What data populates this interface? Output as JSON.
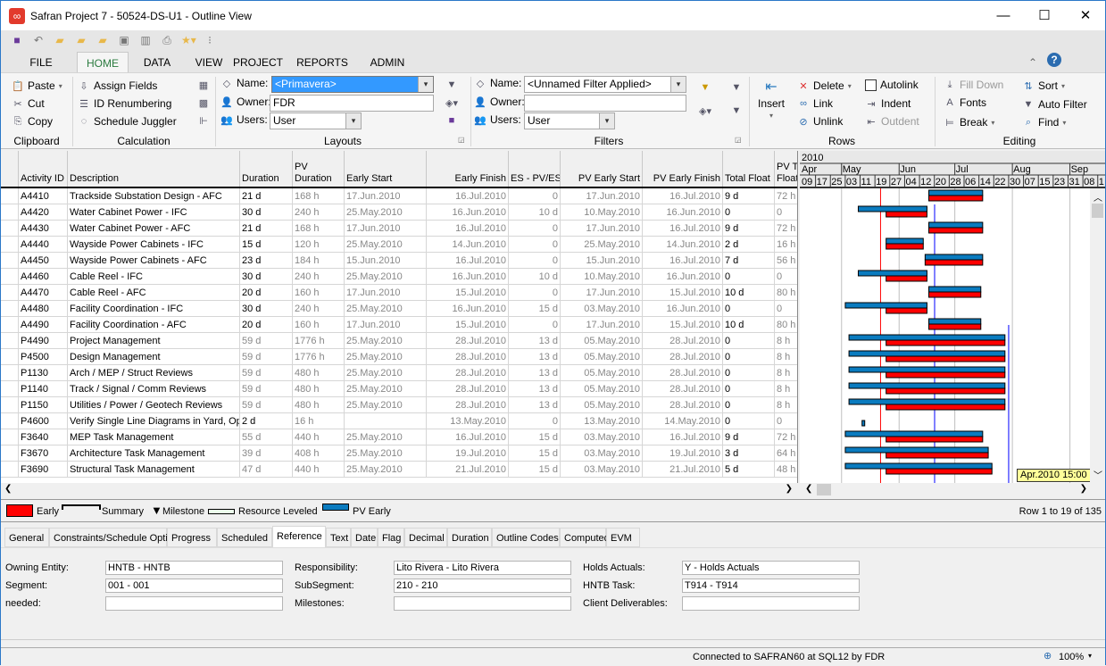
{
  "window": {
    "title": "Safran Project 7 - 50524-DS-U1 - Outline View",
    "minimize": "—",
    "maximize": "☐",
    "close": "✕"
  },
  "ribbon_tabs": [
    "FILE",
    "HOME",
    "DATA",
    "VIEW",
    "PROJECT",
    "REPORTS",
    "ADMIN"
  ],
  "active_tab": "HOME",
  "clipboard": {
    "paste": "Paste",
    "cut": "Cut",
    "copy": "Copy",
    "label": "Clipboard"
  },
  "calculation": {
    "assign": "Assign Fields",
    "renumber": "ID Renumbering",
    "juggler": "Schedule Juggler",
    "label": "Calculation"
  },
  "layouts": {
    "name_label": "Name:",
    "name_value": "<Primavera>",
    "owner_label": "Owner:",
    "owner_value": "FDR",
    "users_label": "Users:",
    "users_value": "User",
    "label": "Layouts"
  },
  "filters": {
    "name_label": "Name:",
    "name_value": "<Unnamed Filter Applied>",
    "owner_label": "Owner:",
    "owner_value": "",
    "users_label": "Users:",
    "users_value": "User",
    "label": "Filters"
  },
  "rows_group": {
    "insert": "Insert",
    "delete": "Delete",
    "link": "Link",
    "unlink": "Unlink",
    "autolink": "Autolink",
    "indent": "Indent",
    "outdent": "Outdent",
    "label": "Rows"
  },
  "editing": {
    "filldown": "Fill Down",
    "fonts": "Fonts",
    "break": "Break",
    "sort": "Sort",
    "autofilter": "Auto Filter",
    "find": "Find",
    "label": "Editing"
  },
  "columns": [
    "Activity ID",
    "Description",
    "Duration",
    "PV Duration",
    "Early Start",
    "Early Finish",
    "ES - PV/ES",
    "PV Early Start",
    "PV Early Finish",
    "Total Float",
    "PV T Float"
  ],
  "rows": [
    {
      "id": "A4410",
      "desc": "Trackside Substation Design - AFC",
      "dur": "21 d",
      "pvdur": "168 h",
      "es": "17.Jun.2010",
      "ef": "16.Jul.2010",
      "espv": "0",
      "pves": "17.Jun.2010",
      "pvef": "16.Jul.2010",
      "tf": "9 d",
      "pvtf": "72 h",
      "dur_muted": false
    },
    {
      "id": "A4420",
      "desc": "Water Cabinet Power - IFC",
      "dur": "30 d",
      "pvdur": "240 h",
      "es": "25.May.2010",
      "ef": "16.Jun.2010",
      "espv": "10 d",
      "pves": "10.May.2010",
      "pvef": "16.Jun.2010",
      "tf": "0",
      "pvtf": "0",
      "dur_muted": false
    },
    {
      "id": "A4430",
      "desc": "Water Cabinet Power - AFC",
      "dur": "21 d",
      "pvdur": "168 h",
      "es": "17.Jun.2010",
      "ef": "16.Jul.2010",
      "espv": "0",
      "pves": "17.Jun.2010",
      "pvef": "16.Jul.2010",
      "tf": "9 d",
      "pvtf": "72 h",
      "dur_muted": false
    },
    {
      "id": "A4440",
      "desc": "Wayside Power Cabinets - IFC",
      "dur": "15 d",
      "pvdur": "120 h",
      "es": "25.May.2010",
      "ef": "14.Jun.2010",
      "espv": "0",
      "pves": "25.May.2010",
      "pvef": "14.Jun.2010",
      "tf": "2 d",
      "pvtf": "16 h",
      "dur_muted": false
    },
    {
      "id": "A4450",
      "desc": "Wayside Power Cabinets - AFC",
      "dur": "23 d",
      "pvdur": "184 h",
      "es": "15.Jun.2010",
      "ef": "16.Jul.2010",
      "espv": "0",
      "pves": "15.Jun.2010",
      "pvef": "16.Jul.2010",
      "tf": "7 d",
      "pvtf": "56 h",
      "dur_muted": false
    },
    {
      "id": "A4460",
      "desc": "Cable Reel - IFC",
      "dur": "30 d",
      "pvdur": "240 h",
      "es": "25.May.2010",
      "ef": "16.Jun.2010",
      "espv": "10 d",
      "pves": "10.May.2010",
      "pvef": "16.Jun.2010",
      "tf": "0",
      "pvtf": "0",
      "dur_muted": false
    },
    {
      "id": "A4470",
      "desc": "Cable Reel - AFC",
      "dur": "20 d",
      "pvdur": "160 h",
      "es": "17.Jun.2010",
      "ef": "15.Jul.2010",
      "espv": "0",
      "pves": "17.Jun.2010",
      "pvef": "15.Jul.2010",
      "tf": "10 d",
      "pvtf": "80 h",
      "dur_muted": false
    },
    {
      "id": "A4480",
      "desc": "Facility Coordination - IFC",
      "dur": "30 d",
      "pvdur": "240 h",
      "es": "25.May.2010",
      "ef": "16.Jun.2010",
      "espv": "15 d",
      "pves": "03.May.2010",
      "pvef": "16.Jun.2010",
      "tf": "0",
      "pvtf": "0",
      "dur_muted": false
    },
    {
      "id": "A4490",
      "desc": "Facility Coordination - AFC",
      "dur": "20 d",
      "pvdur": "160 h",
      "es": "17.Jun.2010",
      "ef": "15.Jul.2010",
      "espv": "0",
      "pves": "17.Jun.2010",
      "pvef": "15.Jul.2010",
      "tf": "10 d",
      "pvtf": "80 h",
      "dur_muted": false
    },
    {
      "id": "P4490",
      "desc": "Project Management",
      "dur": "59 d",
      "pvdur": "1776 h",
      "es": "25.May.2010",
      "ef": "28.Jul.2010",
      "espv": "13 d",
      "pves": "05.May.2010",
      "pvef": "28.Jul.2010",
      "tf": "0",
      "pvtf": "8 h",
      "dur_muted": true
    },
    {
      "id": "P4500",
      "desc": "Design Management",
      "dur": "59 d",
      "pvdur": "1776 h",
      "es": "25.May.2010",
      "ef": "28.Jul.2010",
      "espv": "13 d",
      "pves": "05.May.2010",
      "pvef": "28.Jul.2010",
      "tf": "0",
      "pvtf": "8 h",
      "dur_muted": true
    },
    {
      "id": "P1130",
      "desc": "Arch / MEP / Struct Reviews",
      "dur": "59 d",
      "pvdur": "480 h",
      "es": "25.May.2010",
      "ef": "28.Jul.2010",
      "espv": "13 d",
      "pves": "05.May.2010",
      "pvef": "28.Jul.2010",
      "tf": "0",
      "pvtf": "8 h",
      "dur_muted": true
    },
    {
      "id": "P1140",
      "desc": "Track / Signal / Comm Reviews",
      "dur": "59 d",
      "pvdur": "480 h",
      "es": "25.May.2010",
      "ef": "28.Jul.2010",
      "espv": "13 d",
      "pves": "05.May.2010",
      "pvef": "28.Jul.2010",
      "tf": "0",
      "pvtf": "8 h",
      "dur_muted": true
    },
    {
      "id": "P1150",
      "desc": "Utilities / Power / Geotech Reviews",
      "dur": "59 d",
      "pvdur": "480 h",
      "es": "25.May.2010",
      "ef": "28.Jul.2010",
      "espv": "13 d",
      "pves": "05.May.2010",
      "pvef": "28.Jul.2010",
      "tf": "0",
      "pvtf": "8 h",
      "dur_muted": true
    },
    {
      "id": "P4600",
      "desc": "Verify Single Line Diagrams in Yard, Ope",
      "dur": "2 d",
      "pvdur": "16 h",
      "es": "",
      "ef": "13.May.2010",
      "espv": "0",
      "pves": "13.May.2010",
      "pvef": "14.May.2010",
      "tf": "0",
      "pvtf": "0",
      "dur_muted": false
    },
    {
      "id": "F3640",
      "desc": "MEP Task Management",
      "dur": "55 d",
      "pvdur": "440 h",
      "es": "25.May.2010",
      "ef": "16.Jul.2010",
      "espv": "15 d",
      "pves": "03.May.2010",
      "pvef": "16.Jul.2010",
      "tf": "9 d",
      "pvtf": "72 h",
      "dur_muted": true
    },
    {
      "id": "F3670",
      "desc": "Architecture Task Management",
      "dur": "39 d",
      "pvdur": "408 h",
      "es": "25.May.2010",
      "ef": "19.Jul.2010",
      "espv": "15 d",
      "pves": "03.May.2010",
      "pvef": "19.Jul.2010",
      "tf": "3 d",
      "pvtf": "64 h",
      "dur_muted": true
    },
    {
      "id": "F3690",
      "desc": "Structural Task Management",
      "dur": "47 d",
      "pvdur": "440 h",
      "es": "25.May.2010",
      "ef": "21.Jul.2010",
      "espv": "15 d",
      "pves": "03.May.2010",
      "pvef": "21.Jul.2010",
      "tf": "5 d",
      "pvtf": "48 h",
      "dur_muted": true
    }
  ],
  "gantt": {
    "year": "2010",
    "months": [
      "Apr",
      "May",
      "Jun",
      "Jul",
      "Aug",
      "Sep"
    ],
    "days": [
      "09",
      "17",
      "25",
      "03",
      "11",
      "19",
      "27",
      "04",
      "12",
      "20",
      "28",
      "06",
      "14",
      "22",
      "30",
      "07",
      "15",
      "23",
      "31",
      "08",
      "1"
    ],
    "tooltip": "Apr.2010 15:00",
    "early_color": "#ff0000",
    "pv_early_color": "#0a7bbf",
    "link_color": "#0000ff",
    "data_date_color": "#ff0000"
  },
  "legend": {
    "early": "Early",
    "summary": "Summary",
    "milestone": "Milestone",
    "resource_leveled": "Resource Leveled",
    "pv_early": "PV Early",
    "row_count": "Row 1 to 19 of 135"
  },
  "detail_tabs": [
    "General",
    "Constraints/Schedule Options",
    "Progress",
    "Scheduled",
    "Reference",
    "Text",
    "Date",
    "Flag",
    "Decimal",
    "Duration",
    "Outline Codes",
    "Computed",
    "EVM"
  ],
  "active_detail_tab": "Reference",
  "detail": {
    "owning_entity_label": "Owning Entity:",
    "owning_entity": "HNTB - HNTB",
    "segment_label": "Segment:",
    "segment": "001 - 001",
    "needed_label": "needed:",
    "needed": "",
    "responsibility_label": "Responsibility:",
    "responsibility": "Lito Rivera - Lito Rivera",
    "subsegment_label": "SubSegment:",
    "subsegment": "210 - 210",
    "milestones_label": "Milestones:",
    "milestones": "",
    "holds_actuals_label": "Holds Actuals:",
    "holds_actuals": "Y - Holds Actuals",
    "hntb_task_label": "HNTB Task:",
    "hntb_task": "T914 - T914",
    "client_deliverables_label": "Client Deliverables:",
    "client_deliverables": ""
  },
  "status": {
    "connection": "Connected to SAFRAN60 at SQL12 by FDR",
    "zoom": "100%"
  }
}
